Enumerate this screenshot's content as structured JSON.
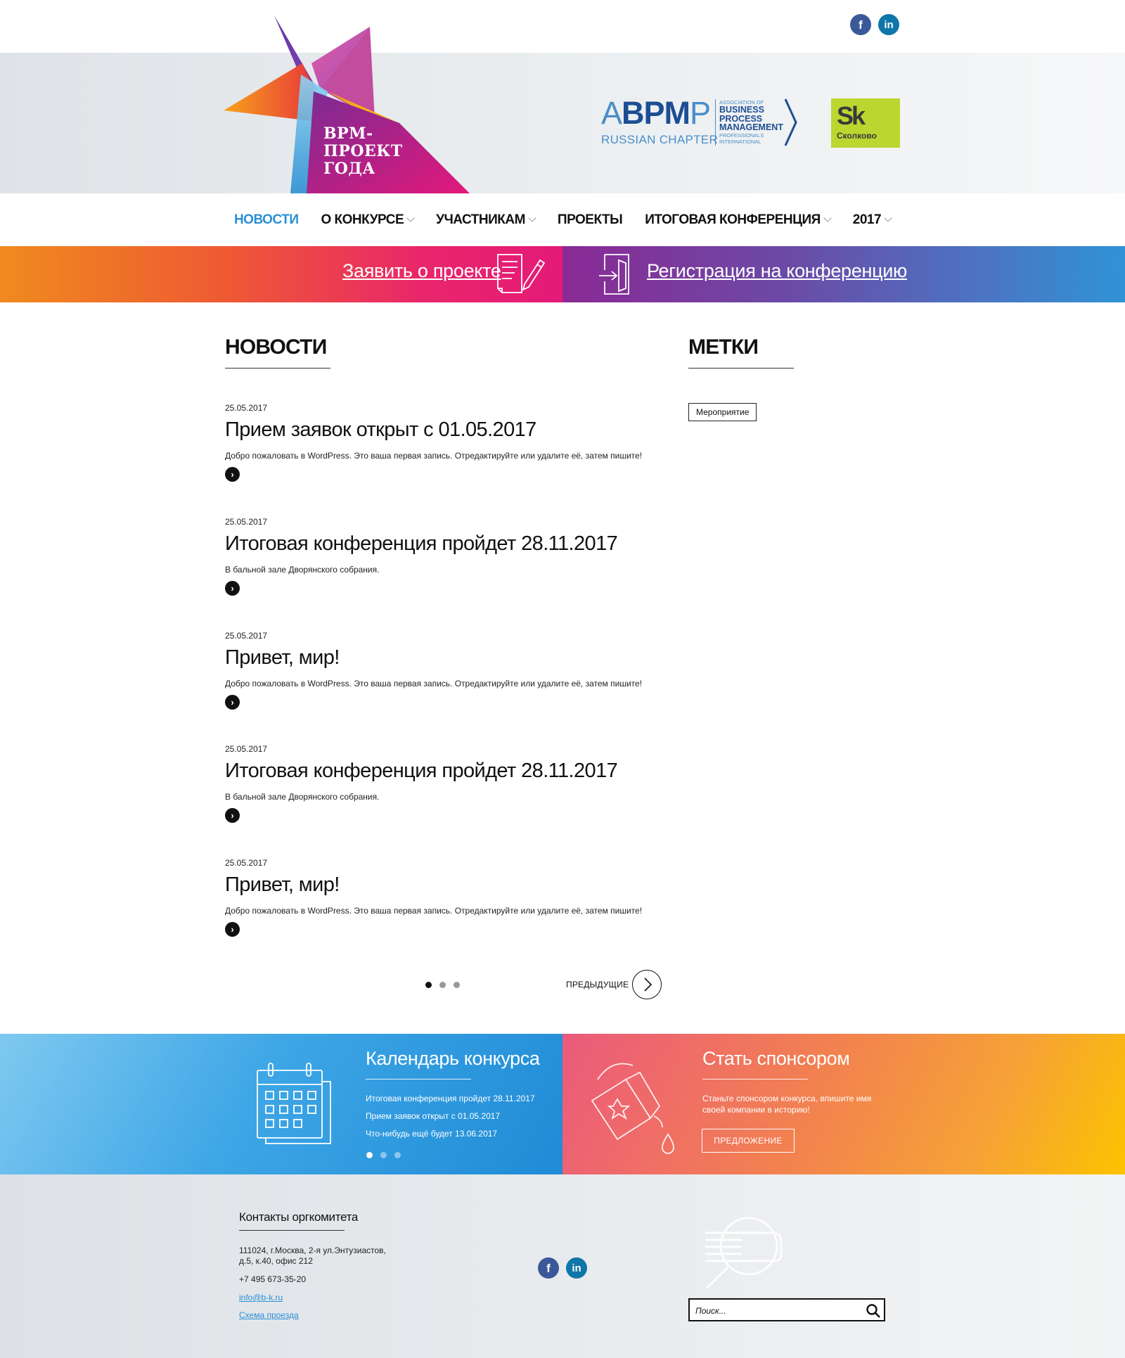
{
  "header": {
    "logo_lines": [
      "BPM-",
      "ПРОЕКТ",
      "ГОДА"
    ],
    "social": {
      "facebook": "f",
      "linkedin": "in"
    },
    "partner_abpmp": {
      "big_left": "A",
      "big_mid": "BPM",
      "big_right": "P",
      "sub": "RUSSIAN CHAPTER",
      "line1": "ASSOCIATION OF",
      "line2": "BUSINESS",
      "line3": "PROCESS",
      "line4": "MANAGEMENT",
      "line5": "PROFESSIONALS",
      "line6": "INTERNATIONAL"
    },
    "partner_sk": {
      "big": "Sk",
      "small": "Сколково"
    }
  },
  "nav": {
    "items": [
      {
        "label": "НОВОСТИ",
        "active": true,
        "dropdown": false
      },
      {
        "label": "О КОНКУРСЕ",
        "active": false,
        "dropdown": true
      },
      {
        "label": "УЧАСТНИКАМ",
        "active": false,
        "dropdown": true
      },
      {
        "label": "ПРОЕКТЫ",
        "active": false,
        "dropdown": false
      },
      {
        "label": "ИТОГОВАЯ КОНФЕРЕНЦИЯ",
        "active": false,
        "dropdown": true
      },
      {
        "label": "2017",
        "active": false,
        "dropdown": true
      }
    ]
  },
  "cta": {
    "left_label": "Заявить о проекте",
    "right_label": "Регистрация на конференцию",
    "left_icon": "document-pen-icon",
    "right_icon": "door-enter-icon"
  },
  "news": {
    "title": "НОВОСТИ",
    "items": [
      {
        "date": "25.05.2017",
        "title": "Прием заявок открыт с 01.05.2017",
        "excerpt": "Добро пожаловать в WordPress. Это ваша первая запись. Отредактируйте или удалите её, затем пишите!"
      },
      {
        "date": "25.05.2017",
        "title": "Итоговая конференция пройдет 28.11.2017",
        "excerpt": "В бальной зале Дворянского собрания."
      },
      {
        "date": "25.05.2017",
        "title": "Привет, мир!",
        "excerpt": "Добро пожаловать в WordPress. Это ваша первая запись. Отредактируйте или удалите её, затем пишите!"
      },
      {
        "date": "25.05.2017",
        "title": "Итоговая конференция пройдет 28.11.2017",
        "excerpt": "В бальной зале Дворянского собрания."
      },
      {
        "date": "25.05.2017",
        "title": "Привет, мир!",
        "excerpt": "Добро пожаловать в WordPress. Это ваша первая запись. Отредактируйте или удалите её, затем пишите!"
      }
    ],
    "pagination_pages": 3,
    "pagination_current": 1,
    "prev_label": "ПРЕДЫДУЩИЕ"
  },
  "tags": {
    "title": "МЕТКИ",
    "items": [
      "Мероприятие"
    ]
  },
  "calendar": {
    "title": "Календарь конкурса",
    "items": [
      "Итоговая конференция пройдет 28.11.2017",
      "Прием заявок открыт с 01.05.2017",
      "Что-нибудь ещё будет 13.06.2017"
    ],
    "slides": 3,
    "current_slide": 1
  },
  "sponsor": {
    "title": "Стать спонсором",
    "text_line1": "Станьте спонсором конкурса, впишите имя",
    "text_line2": "своей компании в историю!",
    "button": "ПРЕДЛОЖЕНИЕ"
  },
  "footer": {
    "title": "Контакты оргкомитета",
    "address_line1": "111024, г.Москва, 2-я ул.Энтузиастов,",
    "address_line2": "д.5, к.40, офис 212",
    "phone": "+7 495 673-35-20",
    "email": "info@b-k.ru",
    "map_link": "Схема проезда",
    "search_placeholder": "Поиск..."
  },
  "colors": {
    "accent_blue": "#2a8fd6",
    "cta_orange": "#f08a1e",
    "cta_pink": "#e41a78",
    "cta_purple": "#8a2a95",
    "sk_green": "#bcd630"
  }
}
